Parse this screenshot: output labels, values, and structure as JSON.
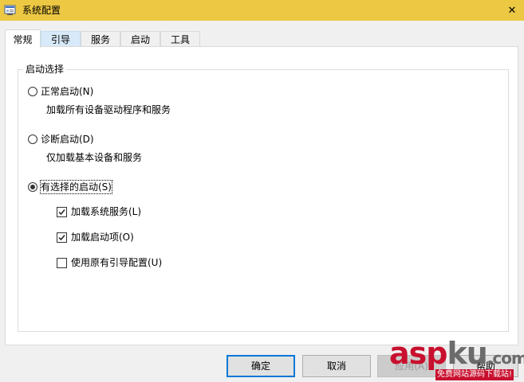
{
  "window": {
    "title": "系统配置",
    "close_glyph": "✕",
    "titlebar_color": "#ecc843"
  },
  "tabs": [
    {
      "label": "常规",
      "active": true
    },
    {
      "label": "引导",
      "active": false
    },
    {
      "label": "服务",
      "active": false
    },
    {
      "label": "启动",
      "active": false
    },
    {
      "label": "工具",
      "active": false
    }
  ],
  "startup_selection": {
    "legend": "启动选择",
    "normal": {
      "label": "正常启动(N)",
      "description": "加载所有设备驱动程序和服务",
      "checked": false
    },
    "diagnostic": {
      "label": "诊断启动(D)",
      "description": "仅加载基本设备和服务",
      "checked": false
    },
    "selective": {
      "label": "有选择的启动(S)",
      "checked": true,
      "options": {
        "load_system_services": {
          "label": "加载系统服务(L)",
          "checked": true
        },
        "load_startup_items": {
          "label": "加载启动项(O)",
          "checked": true
        },
        "use_original_boot_config": {
          "label": "使用原有引导配置(U)",
          "checked": false
        }
      }
    }
  },
  "buttons": {
    "ok": "确定",
    "cancel": "取消",
    "apply": "应用(A)",
    "help": "帮助"
  },
  "watermark": {
    "brand_part1": "asp",
    "brand_part2": "ku",
    "brand_part3": ".com",
    "tagline": "免费网站源码下载站!"
  }
}
